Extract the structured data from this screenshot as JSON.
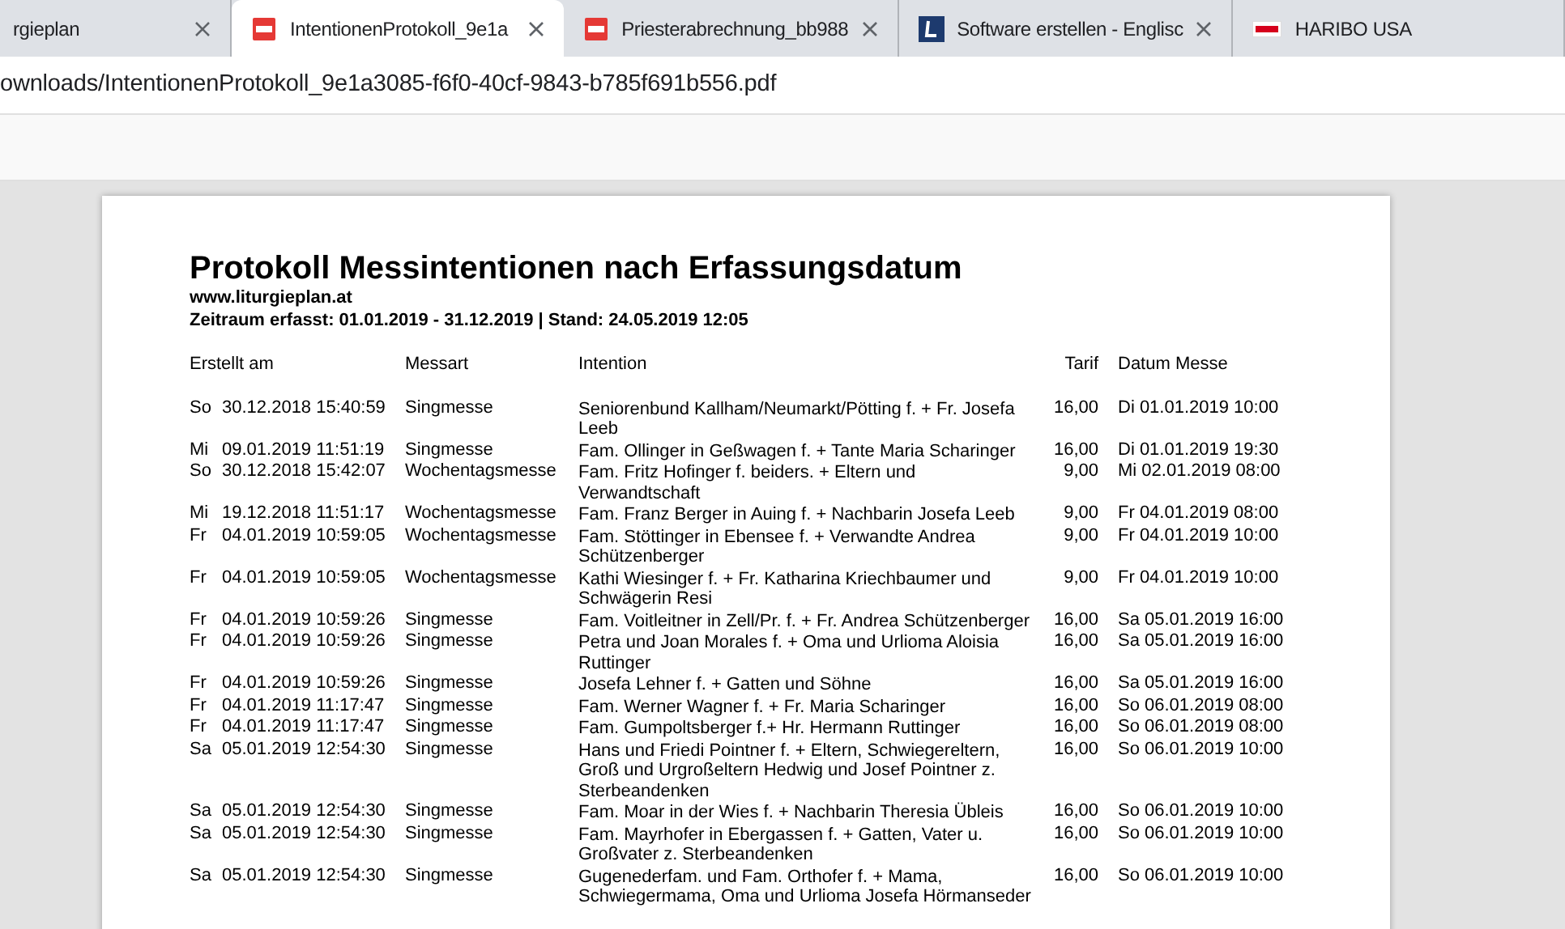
{
  "tabs": [
    {
      "title": "rgieplan",
      "kind": "plain",
      "selected": false,
      "closable": true
    },
    {
      "title": "IntentionenProtokoll_9e1a",
      "kind": "pdf",
      "selected": true,
      "closable": true
    },
    {
      "title": "Priesterabrechnung_bb988",
      "kind": "pdf",
      "selected": false,
      "closable": true
    },
    {
      "title": "Software erstellen - Englisc",
      "kind": "dictionary",
      "selected": false,
      "closable": true
    },
    {
      "title": "HARIBO USA",
      "kind": "brand",
      "selected": false,
      "closable": false
    }
  ],
  "address": "ownloads/IntentionenProtokoll_9e1a3085-f6f0-40cf-9843-b785f691b556.pdf",
  "document": {
    "title": "Protokoll Messintentionen nach Erfassungsdatum",
    "website": "www.liturgieplan.at",
    "period": "Zeitraum erfasst: 01.01.2019 - 31.12.2019 | Stand: 24.05.2019 12:05",
    "columns": [
      "Erstellt am",
      "Messart",
      "Intention",
      "Tarif",
      "Datum Messe"
    ],
    "rows": [
      {
        "day": "So",
        "created": "30.12.2018 15:40:59",
        "type": "Singmesse",
        "intention": "Seniorenbund Kallham/Neumarkt/Pötting f. + Fr. Josefa Leeb",
        "tarif": "16,00",
        "mass_date": "Di 01.01.2019 10:00"
      },
      {
        "day": "Mi",
        "created": "09.01.2019 11:51:19",
        "type": "Singmesse",
        "intention": "Fam. Ollinger in Geßwagen f. + Tante Maria Scharinger",
        "tarif": "16,00",
        "mass_date": "Di 01.01.2019 19:30"
      },
      {
        "day": "So",
        "created": "30.12.2018 15:42:07",
        "type": "Wochentagsmesse",
        "intention": "Fam. Fritz Hofinger f. beiders. + Eltern und Verwandtschaft",
        "tarif": "9,00",
        "mass_date": "Mi 02.01.2019 08:00"
      },
      {
        "day": "Mi",
        "created": "19.12.2018 11:51:17",
        "type": "Wochentagsmesse",
        "intention": "Fam. Franz Berger in Auing f. + Nachbarin Josefa Leeb",
        "tarif": "9,00",
        "mass_date": "Fr 04.01.2019 08:00"
      },
      {
        "day": "Fr",
        "created": "04.01.2019 10:59:05",
        "type": "Wochentagsmesse",
        "intention": "Fam. Stöttinger in Ebensee f. + Verwandte Andrea Schützenberger",
        "tarif": "9,00",
        "mass_date": "Fr 04.01.2019 10:00"
      },
      {
        "day": "Fr",
        "created": "04.01.2019 10:59:05",
        "type": "Wochentagsmesse",
        "intention": "Kathi Wiesinger f. + Fr. Katharina Kriechbaumer und Schwägerin Resi",
        "tarif": "9,00",
        "mass_date": "Fr 04.01.2019 10:00"
      },
      {
        "day": "Fr",
        "created": "04.01.2019 10:59:26",
        "type": "Singmesse",
        "intention": "Fam. Voitleitner in Zell/Pr. f. + Fr. Andrea Schützenberger",
        "tarif": "16,00",
        "mass_date": "Sa 05.01.2019 16:00"
      },
      {
        "day": "Fr",
        "created": "04.01.2019 10:59:26",
        "type": "Singmesse",
        "intention": "Petra und Joan Morales f. + Oma und Urlioma Aloisia Ruttinger",
        "tarif": "16,00",
        "mass_date": "Sa 05.01.2019 16:00"
      },
      {
        "day": "Fr",
        "created": "04.01.2019 10:59:26",
        "type": "Singmesse",
        "intention": "Josefa Lehner f. + Gatten und Söhne",
        "tarif": "16,00",
        "mass_date": "Sa 05.01.2019 16:00"
      },
      {
        "day": "Fr",
        "created": "04.01.2019 11:17:47",
        "type": "Singmesse",
        "intention": "Fam. Werner Wagner f. + Fr. Maria Scharinger",
        "tarif": "16,00",
        "mass_date": "So 06.01.2019 08:00"
      },
      {
        "day": "Fr",
        "created": "04.01.2019 11:17:47",
        "type": "Singmesse",
        "intention": "Fam. Gumpoltsberger f.+ Hr. Hermann Ruttinger",
        "tarif": "16,00",
        "mass_date": "So 06.01.2019 08:00"
      },
      {
        "day": "Sa",
        "created": "05.01.2019 12:54:30",
        "type": "Singmesse",
        "intention": "Hans und Friedi Pointner f. + Eltern, Schwiegereltern, Groß und Urgroßeltern Hedwig und Josef Pointner  z. Sterbeandenken",
        "tarif": "16,00",
        "mass_date": "So 06.01.2019 10:00"
      },
      {
        "day": "Sa",
        "created": "05.01.2019 12:54:30",
        "type": "Singmesse",
        "intention": "Fam. Moar in der Wies f. + Nachbarin Theresia Übleis",
        "tarif": "16,00",
        "mass_date": "So 06.01.2019 10:00"
      },
      {
        "day": "Sa",
        "created": "05.01.2019 12:54:30",
        "type": "Singmesse",
        "intention": "Fam. Mayrhofer in Ebergassen f. + Gatten, Vater u. Großvater z. Sterbeandenken",
        "tarif": "16,00",
        "mass_date": "So 06.01.2019 10:00"
      },
      {
        "day": "Sa",
        "created": "05.01.2019 12:54:30",
        "type": "Singmesse",
        "intention": "Gugenederfam. und Fam. Orthofer f. + Mama, Schwiegermama, Oma und Urlioma Josefa Hörmanseder",
        "tarif": "16,00",
        "mass_date": "So 06.01.2019 10:00"
      }
    ]
  }
}
